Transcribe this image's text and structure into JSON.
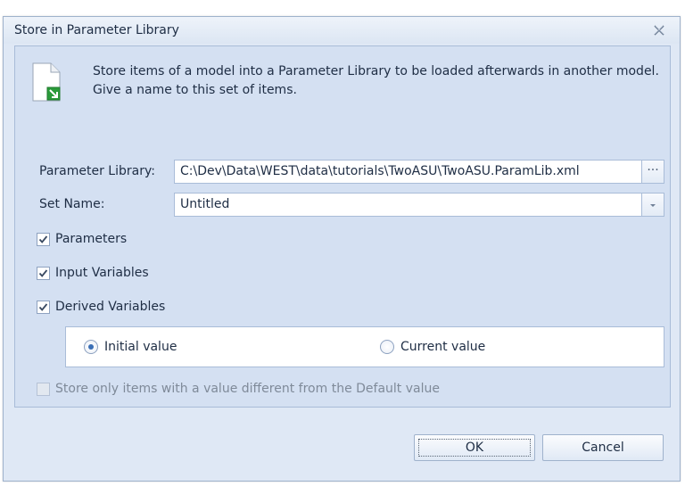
{
  "dialog": {
    "title": "Store in Parameter Library",
    "description": "Store items of a model into a Parameter Library to be loaded afterwards in another model. Give a name to this set of items."
  },
  "form": {
    "parameter_library_label": "Parameter Library:",
    "parameter_library_value": "C:\\Dev\\Data\\WEST\\data\\tutorials\\TwoASU\\TwoASU.ParamLib.xml",
    "browse_label": "···",
    "set_name_label": "Set Name:",
    "set_name_value": "Untitled"
  },
  "checkboxes": {
    "parameters": {
      "label": "Parameters",
      "checked": true
    },
    "input_variables": {
      "label": "Input Variables",
      "checked": true
    },
    "derived_variables": {
      "label": "Derived Variables",
      "checked": true
    },
    "store_only_different": {
      "label": "Store only items with a value different from the Default value",
      "checked": false,
      "enabled": false
    }
  },
  "value_options": {
    "initial": {
      "label": "Initial value",
      "selected": true
    },
    "current": {
      "label": "Current value",
      "selected": false
    }
  },
  "buttons": {
    "ok": "OK",
    "cancel": "Cancel"
  },
  "icons": {
    "close": "close-icon",
    "document": "document-export-icon",
    "dropdown": "chevron-down-icon",
    "check": "checkmark-icon"
  },
  "colors": {
    "dialog_bg": "#dfe8f5",
    "panel_bg": "#d4e0f2",
    "border": "#a9bcd8",
    "text": "#1e2d44",
    "accent_green": "#2a9b3a"
  }
}
